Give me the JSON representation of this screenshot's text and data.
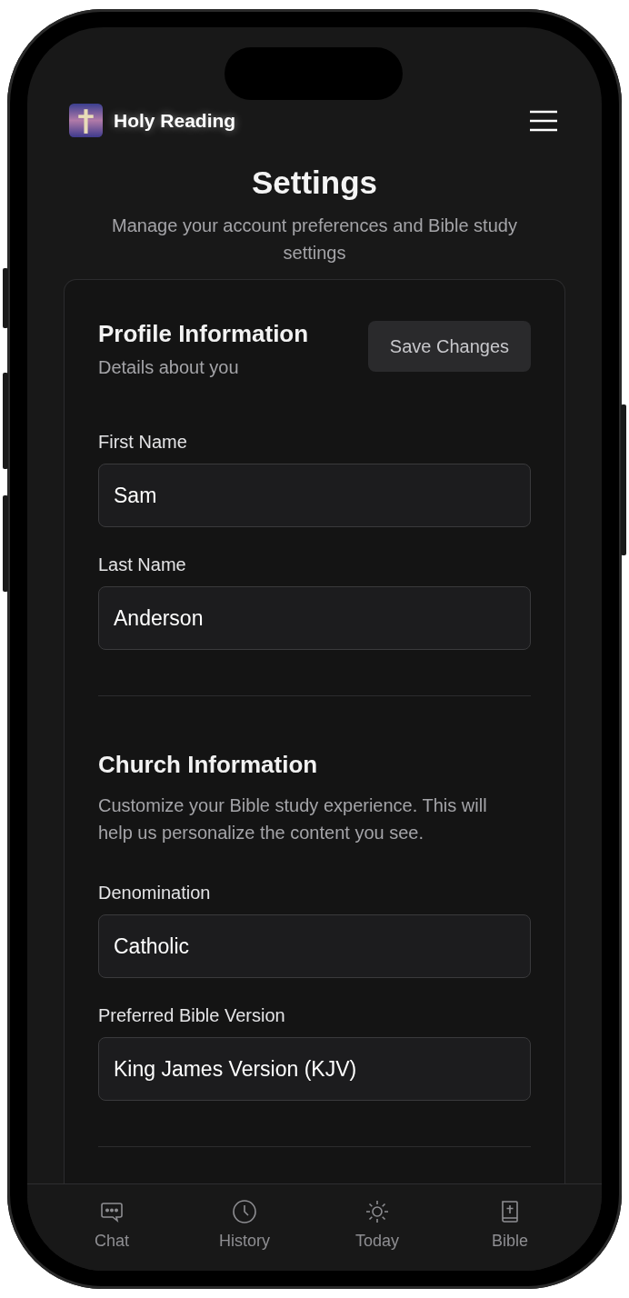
{
  "header": {
    "app_name": "Holy Reading"
  },
  "page": {
    "title": "Settings",
    "subtitle": "Manage your account preferences and Bible study settings"
  },
  "sections": [
    {
      "title": "Profile Information",
      "description": "Details about you",
      "action": "Save Changes",
      "fields": [
        {
          "label": "First Name",
          "value": "Sam"
        },
        {
          "label": "Last Name",
          "value": "Anderson"
        }
      ]
    },
    {
      "title": "Church Information",
      "description": "Customize your Bible study experience. This will help us personalize the content you see.",
      "fields": [
        {
          "label": "Denomination",
          "value": "Catholic"
        },
        {
          "label": "Preferred Bible Version",
          "value": "King James Version (KJV)"
        }
      ]
    }
  ],
  "bottom_nav": [
    {
      "label": "Chat"
    },
    {
      "label": "History"
    },
    {
      "label": "Today"
    },
    {
      "label": "Bible"
    }
  ]
}
